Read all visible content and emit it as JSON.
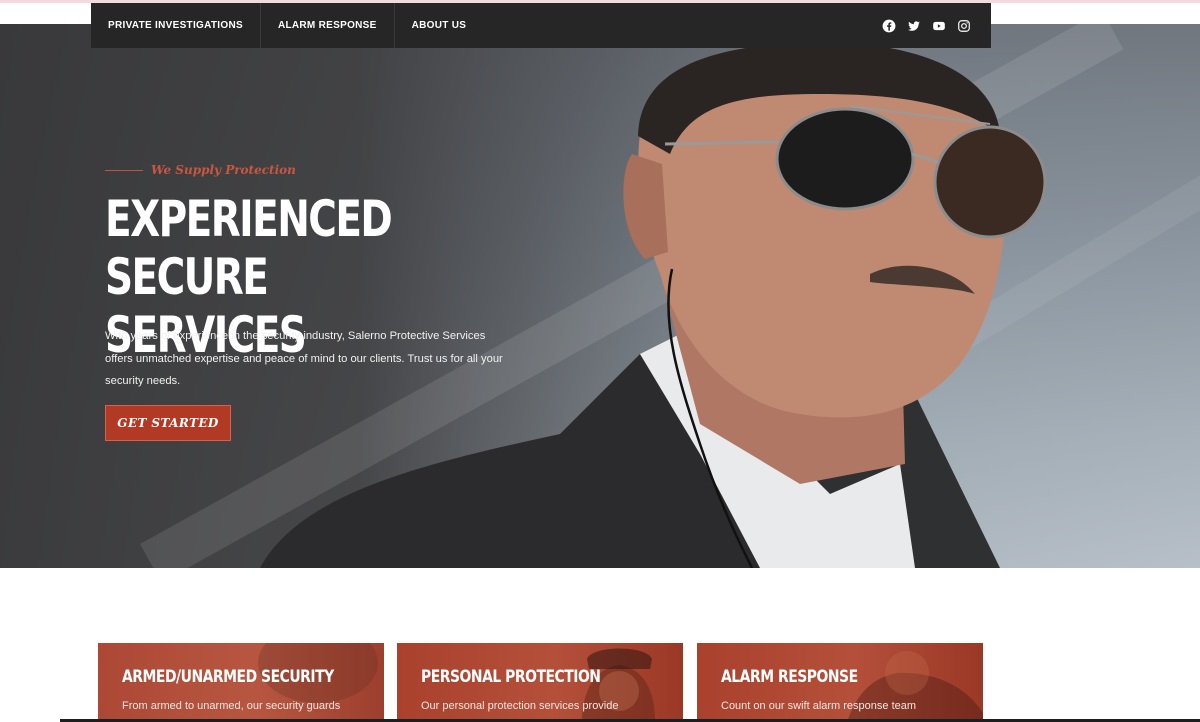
{
  "nav": {
    "items": [
      {
        "label": "PRIVATE INVESTIGATIONS"
      },
      {
        "label": "ALARM RESPONSE"
      },
      {
        "label": "ABOUT US"
      }
    ],
    "social": [
      "facebook-icon",
      "twitter-icon",
      "youtube-icon",
      "instagram-icon"
    ]
  },
  "hero": {
    "tagline": "We Supply Protection",
    "headline_line1": "EXPERIENCED SECURE",
    "headline_line2": "SERVICES",
    "intro_line1": "With years of experience in the security industry, Salerno Protective Services",
    "intro_line2": "offers unmatched expertise and peace of mind to our clients. Trust us for all your",
    "intro_line3": "security needs.",
    "cta_label": "GET STARTED"
  },
  "services": [
    {
      "title": "ARMED/UNARMED SECURITY",
      "description": "From armed to unarmed, our security guards"
    },
    {
      "title": "PERSONAL PROTECTION",
      "description": "Our personal protection services provide"
    },
    {
      "title": "ALARM RESPONSE",
      "description": "Count on our swift alarm response team"
    }
  ],
  "colors": {
    "accent": "#b23a25",
    "tagline": "#c9573f",
    "nav_bg": "#262626",
    "card_bg": "#b4503a"
  }
}
